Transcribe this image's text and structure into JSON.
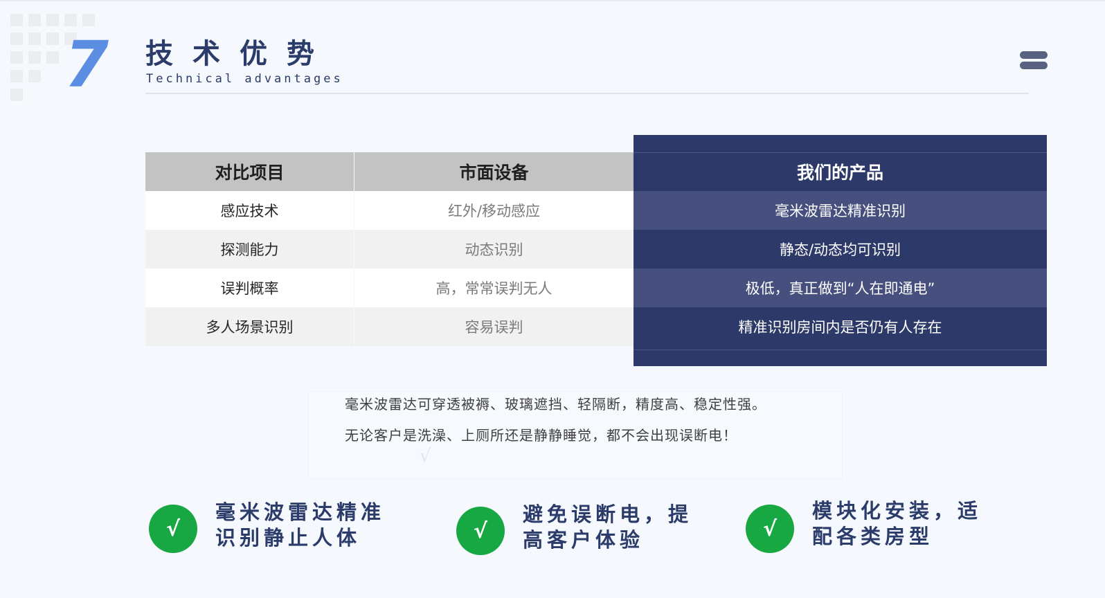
{
  "header": {
    "section_number": "7",
    "title": "技术优势",
    "subtitle": "Technical advantages"
  },
  "menu": {
    "icon": "menu-icon"
  },
  "table": {
    "headers": [
      "对比项目",
      "市面设备",
      "我们的产品"
    ],
    "rows": [
      [
        "感应技术",
        "红外/移动感应",
        "毫米波雷达精准识别"
      ],
      [
        "探测能力",
        "动态识别",
        "静态/动态均可识别"
      ],
      [
        "误判概率",
        "高，常常误判无人",
        "极低，真正做到“人在即通电”"
      ],
      [
        "多人场景识别",
        "容易误判",
        "精准识别房间内是否仍有人存在"
      ]
    ]
  },
  "description": {
    "line1": "毫米波雷达可穿透被褥、玻璃遮挡、轻隔断，精度高、稳定性强。",
    "line2": "无论客户是洗澡、上厕所还是静静睡觉，都不会出现误断电！"
  },
  "features": [
    {
      "icon": "√",
      "line1": "毫米波雷达精准",
      "line2": "识别静止人体"
    },
    {
      "icon": "√",
      "line1": "避免误断电，提",
      "line2": "高客户体验"
    },
    {
      "icon": "√",
      "line1": "模块化安装，适",
      "line2": "配各类房型"
    }
  ],
  "colors": {
    "accent_blue": "#5b8ee2",
    "navy": "#2d3a69",
    "navy_stripe": "#464f7e",
    "header_gray": "#c3c3c3",
    "check_green": "#17a843",
    "title_text": "#2b3b6a"
  }
}
